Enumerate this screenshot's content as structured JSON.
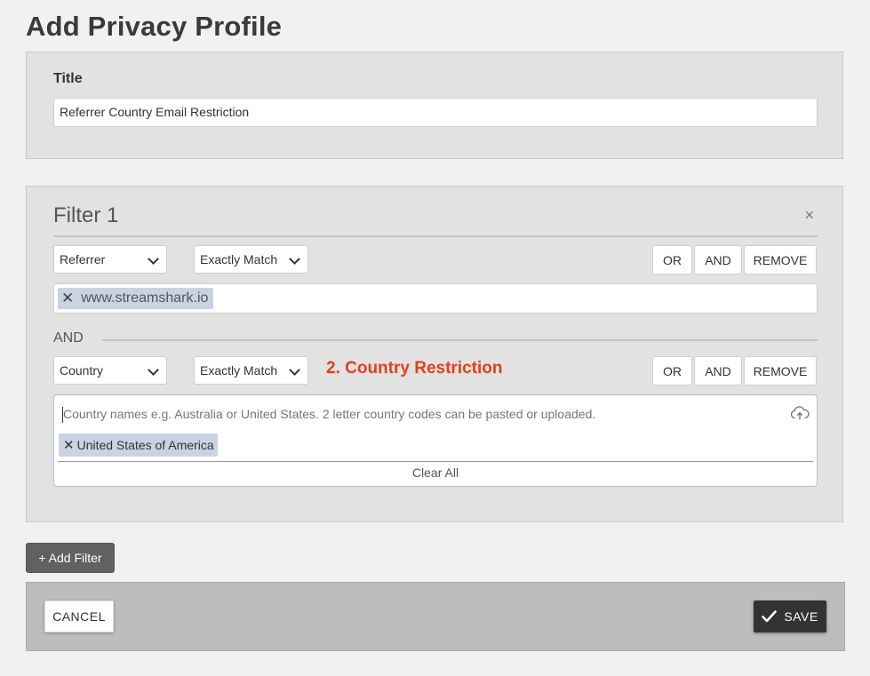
{
  "page": {
    "title": "Add Privacy Profile"
  },
  "title_section": {
    "label": "Title",
    "value": "Referrer Country Email Restriction"
  },
  "filter": {
    "heading": "Filter 1",
    "close_glyph": "×",
    "row1": {
      "field": "Referrer",
      "operator": "Exactly Match",
      "tag": "www.streamshark.io"
    },
    "connector": "AND",
    "row2": {
      "field": "Country",
      "operator": "Exactly Match",
      "annotation": "2. Country Restriction",
      "placeholder": "Country names e.g. Australia or United States. 2 letter country codes can be pasted or uploaded.",
      "tag": "United States of America",
      "clear_all": "Clear All"
    },
    "buttons": {
      "or": "OR",
      "and": "AND",
      "remove": "REMOVE"
    }
  },
  "add_filter_label": "+ Add Filter",
  "footer": {
    "cancel": "CANCEL",
    "save": "SAVE"
  },
  "colors": {
    "annotation": "#e3401d",
    "tag_bg": "#c9d3e3",
    "save_bg": "#333333"
  },
  "icons": [
    "close-icon",
    "chevron-down-icon",
    "remove-tag-icon",
    "cloud-upload-icon",
    "checkmark-icon"
  ]
}
